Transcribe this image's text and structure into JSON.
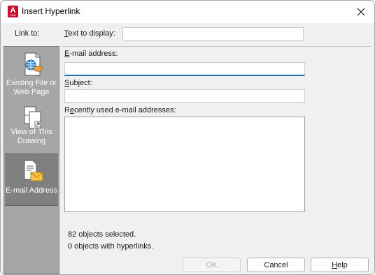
{
  "window": {
    "title": "Insert Hyperlink",
    "app_icon_letter": "A",
    "app_icon_caption": "CAD"
  },
  "link_to": {
    "label": "Link to:",
    "items": [
      {
        "line1": "Existing File or",
        "line2": "Web Page",
        "icon": "globe-file-icon"
      },
      {
        "line1": "View of This",
        "line2": "Drawing",
        "icon": "drawing-view-icon"
      },
      {
        "line1": "E-mail Address",
        "line2": "",
        "icon": "email-icon",
        "active": true
      }
    ]
  },
  "form": {
    "text_to_display": {
      "label_key": "T",
      "label_rest": "ext to display:",
      "value": ""
    },
    "email": {
      "label_key": "E",
      "label_rest": "-mail address:",
      "value": ""
    },
    "subject": {
      "label_key": "S",
      "label_rest": "ubject:",
      "value": ""
    },
    "recent": {
      "label_first": "R",
      "label_key": "e",
      "label_rest": "cently used e-mail addresses:",
      "items": []
    }
  },
  "status": {
    "line1": "82 objects selected.",
    "line2": "0 objects with hyperlinks."
  },
  "buttons": {
    "ok": "OK",
    "cancel": "Cancel",
    "help_key": "H",
    "help_rest": "elp"
  },
  "colors": {
    "panel": "#a6a6a6",
    "active_item": "#808080",
    "focus": "#1f6fb8",
    "app_icon": "#c8102e"
  }
}
